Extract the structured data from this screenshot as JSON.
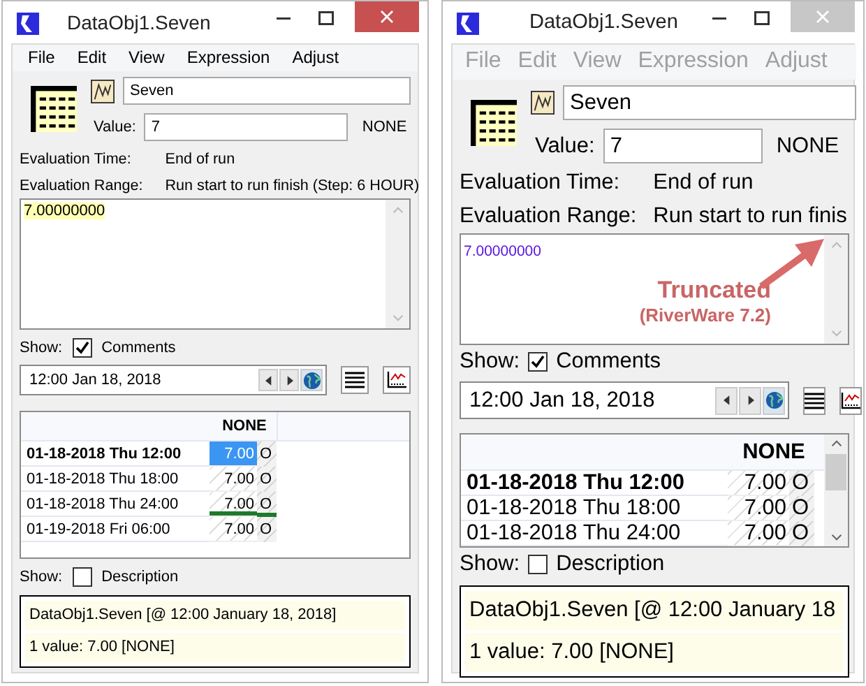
{
  "windows": [
    {
      "kind": "normal",
      "active": true,
      "title": "DataObj1.Seven",
      "menu": [
        {
          "label": "File",
          "disabled": false
        },
        {
          "label": "Edit",
          "disabled": false
        },
        {
          "label": "View",
          "disabled": false
        },
        {
          "label": "Expression",
          "disabled": false
        },
        {
          "label": "Adjust",
          "disabled": false
        }
      ],
      "name": "Seven",
      "value_label": "Value:",
      "value": "7",
      "unit": "NONE",
      "eval_time_label": "Evaluation Time:",
      "eval_time": "End of run",
      "eval_range_label": "Evaluation Range:",
      "eval_range": "Run start to run finish (Step: 6 HOUR)",
      "expression": "7.00000000",
      "show_comments": {
        "label": "Show:",
        "option": "Comments",
        "checked": true
      },
      "date": "12:00 Jan 18, 2018",
      "table": {
        "column": "NONE",
        "rows": [
          {
            "date": "01-18-2018 Thu 12:00",
            "value": "7.00",
            "flag": "O",
            "selected": true,
            "current": true,
            "divider_below": false
          },
          {
            "date": "01-18-2018 Thu 18:00",
            "value": "7.00",
            "flag": "O",
            "selected": false,
            "current": false,
            "divider_below": false
          },
          {
            "date": "01-18-2018 Thu 24:00",
            "value": "7.00",
            "flag": "O",
            "selected": false,
            "current": false,
            "divider_below": true
          },
          {
            "date": "01-19-2018 Fri 06:00",
            "value": "7.00",
            "flag": "O",
            "selected": false,
            "current": false,
            "divider_below": false
          }
        ]
      },
      "show_description": {
        "label": "Show:",
        "option": "Description",
        "checked": false
      },
      "info": [
        "DataObj1.Seven [@ 12:00 January 18, 2018]",
        "1 value:  7.00 [NONE]"
      ]
    },
    {
      "kind": "large",
      "active": false,
      "title": "DataObj1.Seven",
      "menu": [
        {
          "label": "File",
          "disabled": true
        },
        {
          "label": "Edit",
          "disabled": true
        },
        {
          "label": "View",
          "disabled": true
        },
        {
          "label": "Expression",
          "disabled": true
        },
        {
          "label": "Adjust",
          "disabled": true
        }
      ],
      "name": "Seven",
      "value_label": "Value:",
      "value": "7",
      "unit": "NONE",
      "eval_time_label": "Evaluation Time:",
      "eval_time": "End of run",
      "eval_range_label": "Evaluation Range:",
      "eval_range": "Run start to run finis",
      "expression": "7.00000000",
      "show_comments": {
        "label": "Show:",
        "option": "Comments",
        "checked": true
      },
      "date": "12:00 Jan 18, 2018",
      "table": {
        "column": "NONE",
        "rows": [
          {
            "date": "01-18-2018 Thu 12:00",
            "value": "7.00",
            "flag": "O",
            "selected": false,
            "current": true,
            "divider_below": false
          },
          {
            "date": "01-18-2018 Thu 18:00",
            "value": "7.00",
            "flag": "O",
            "selected": false,
            "current": false,
            "divider_below": false
          },
          {
            "date": "01-18-2018 Thu 24:00",
            "value": "7.00",
            "flag": "O",
            "selected": false,
            "current": false,
            "divider_below": false
          }
        ]
      },
      "show_description": {
        "label": "Show:",
        "option": "Description",
        "checked": false
      },
      "info": [
        "DataObj1.Seven [@ 12:00 January 18",
        "1 value:  7.00 [NONE]"
      ]
    }
  ],
  "annotation": {
    "title": "Truncated",
    "subtitle": "(RiverWare 7.2)"
  }
}
